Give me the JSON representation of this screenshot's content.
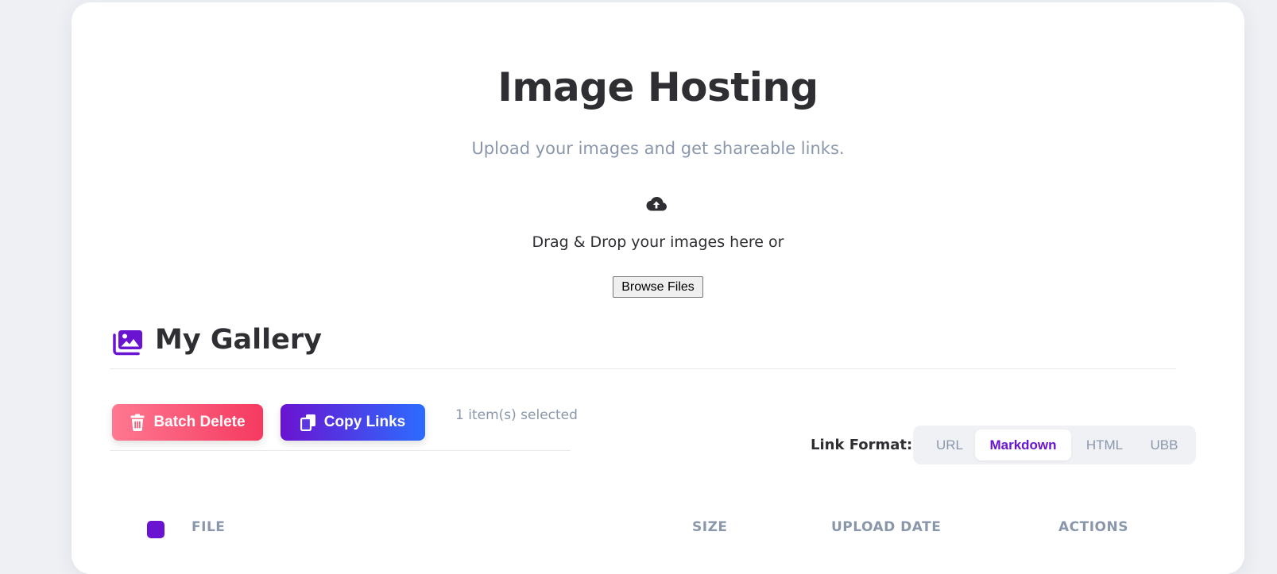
{
  "header": {
    "title": "Image Hosting",
    "subtitle": "Upload your images and get shareable links."
  },
  "upload": {
    "icon": "cloud-upload-icon",
    "drag_text": "Drag & Drop your images here or",
    "browse_label": "Browse Files"
  },
  "gallery": {
    "icon": "images-icon",
    "title": "My Gallery",
    "batch_delete_label": "Batch Delete",
    "copy_links_label": "Copy Links",
    "selected_text": "1 item(s) selected",
    "link_format_label": "Link Format:",
    "formats": [
      "URL",
      "Markdown",
      "HTML",
      "UBB"
    ],
    "active_format": "Markdown",
    "table_headers": [
      "FILE",
      "SIZE",
      "UPLOAD DATE",
      "ACTIONS"
    ],
    "select_all_checked": true
  },
  "colors": {
    "accent": "#6a13d0",
    "delete_gradient": [
      "#ff7890",
      "#f53a60"
    ],
    "copy_gradient": [
      "#6a13d0",
      "#2c6cff"
    ],
    "muted_text": "#8a97ab",
    "title_text": "#2f2f33"
  }
}
